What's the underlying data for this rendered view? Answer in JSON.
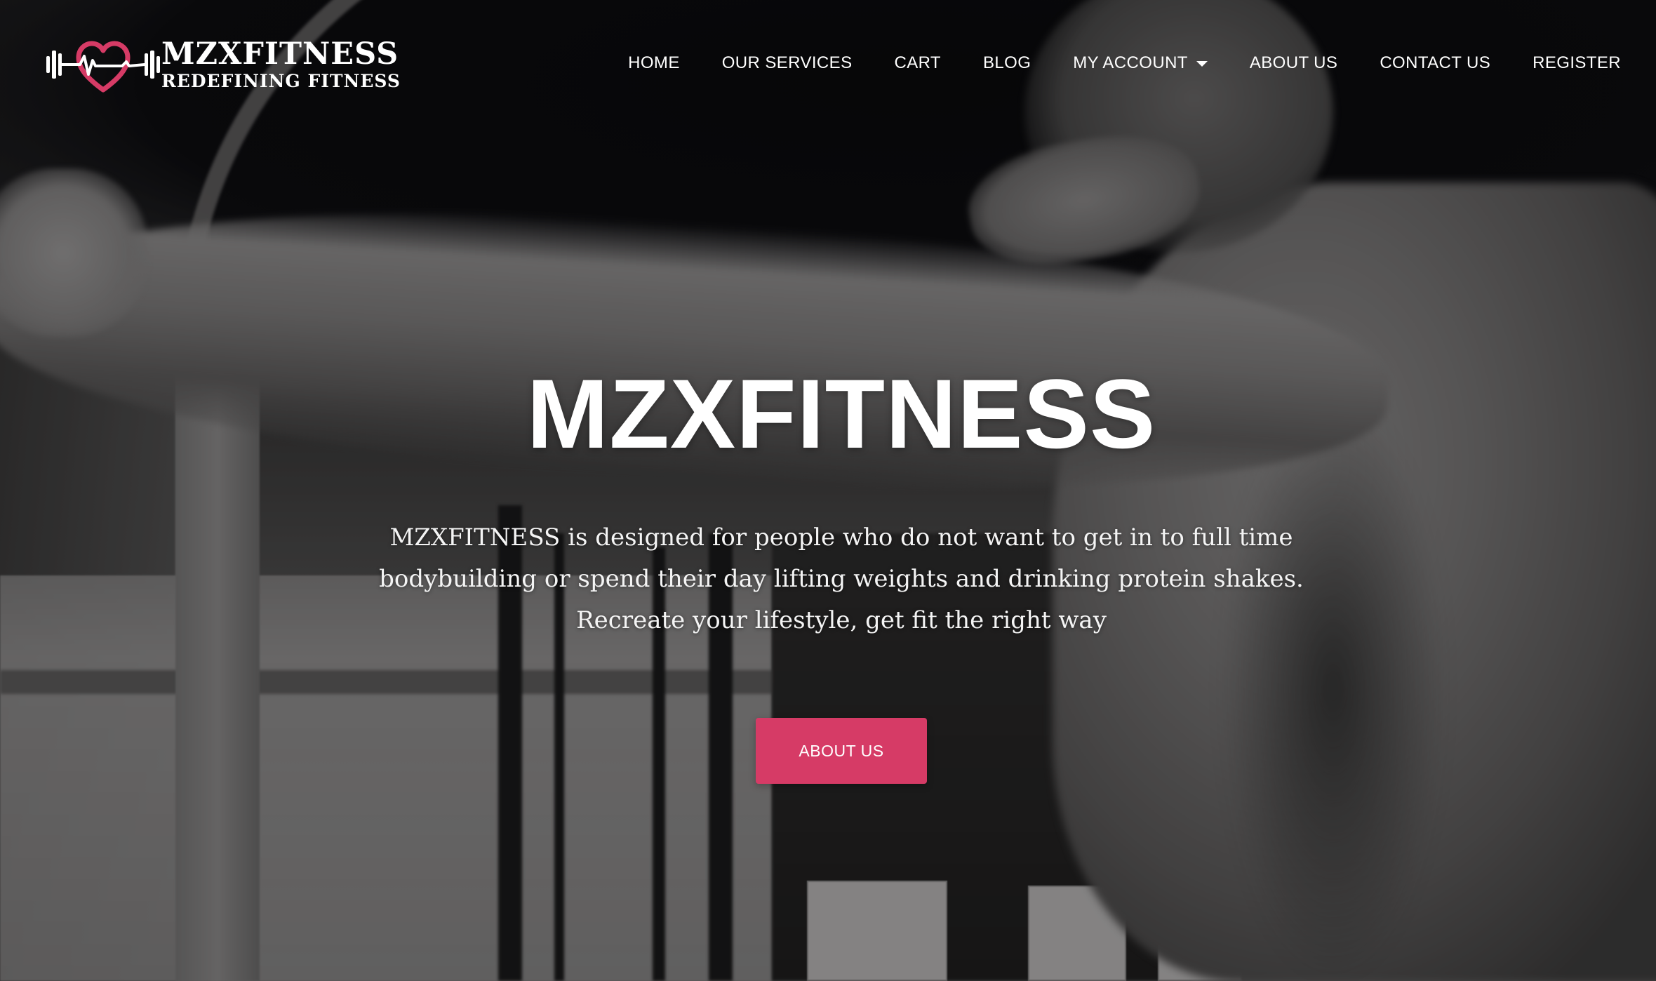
{
  "brand": {
    "name": "MZXFITNESS",
    "tagline": "REDEFINING FITNESS",
    "logo_icon": "heartbeat-dumbbell-icon",
    "accent_color": "#d63b66"
  },
  "nav": {
    "items": [
      {
        "label": "HOME"
      },
      {
        "label": "OUR SERVICES"
      },
      {
        "label": "CART"
      },
      {
        "label": "BLOG"
      },
      {
        "label": "MY ACCOUNT",
        "has_dropdown": true
      },
      {
        "label": "ABOUT US"
      },
      {
        "label": "CONTACT US"
      },
      {
        "label": "REGISTER"
      }
    ]
  },
  "hero": {
    "title": "MZXFITNESS",
    "description": "MZXFITNESS is designed for people who do not want to get in to full time bodybuilding or spend their day lifting weights and drinking protein shakes. Recreate your lifestyle, get fit the right way",
    "button_label": "ABOUT US",
    "background": "grayscale gym photo of man stretching resistance band"
  }
}
